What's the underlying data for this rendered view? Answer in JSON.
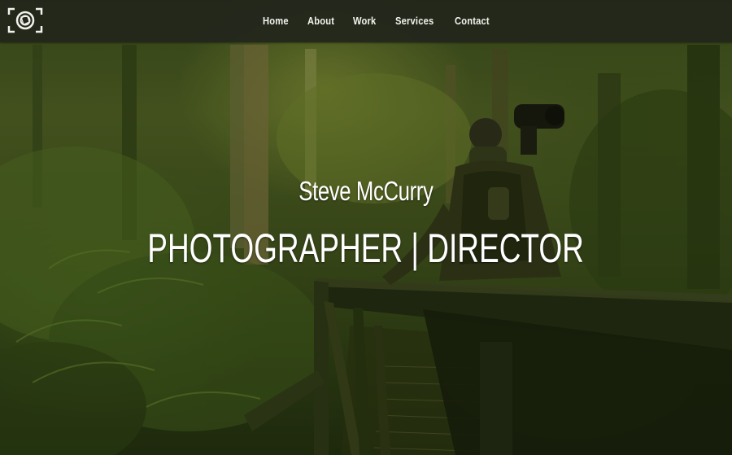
{
  "site": {
    "logo_icon": "camera-aperture-icon"
  },
  "nav": {
    "items": [
      {
        "label": "Home"
      },
      {
        "label": "About"
      },
      {
        "label": "Work"
      },
      {
        "label": "Services"
      },
      {
        "label": "Contact"
      }
    ]
  },
  "hero": {
    "name": "Steve McCurry",
    "title": "PHOTOGRAPHER | DIRECTOR",
    "background_image": "photographer-on-forest-bridge",
    "tint_color": "#4b5a22"
  },
  "colors": {
    "nav_background": "#22261c",
    "nav_text": "#f2f2ec",
    "hero_text": "#ffffff"
  }
}
